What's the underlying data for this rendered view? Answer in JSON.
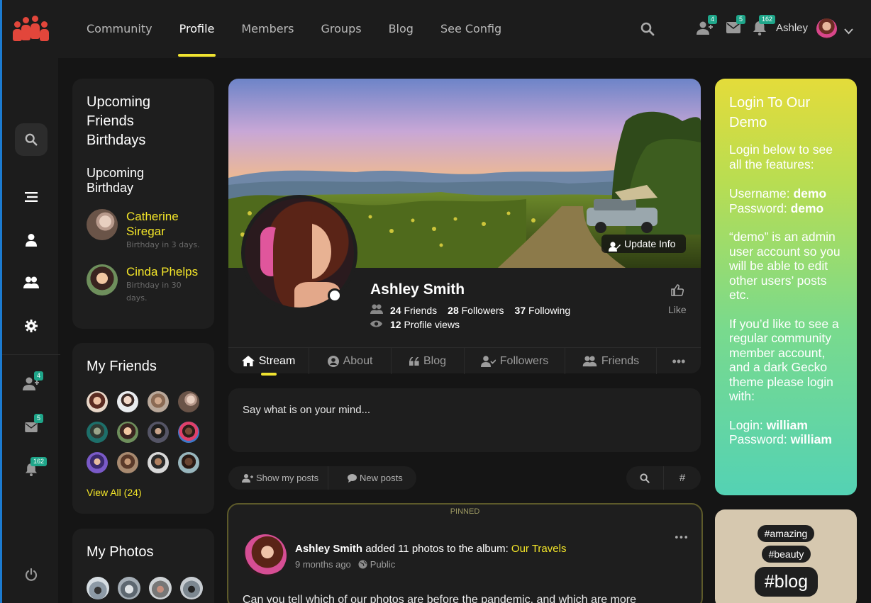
{
  "nav": {
    "items": [
      "Community",
      "Profile",
      "Members",
      "Groups",
      "Blog",
      "See Config"
    ],
    "active": "Profile"
  },
  "header": {
    "friend_requests_count": "4",
    "messages_count": "5",
    "notifications_count": "162",
    "username": "Ashley"
  },
  "sidebar_rail": {
    "friend_requests_count": "4",
    "messages_count": "5",
    "notifications_count": "162"
  },
  "birthdays": {
    "title": "Upcoming Friends Birthdays",
    "subtitle": "Upcoming Birthday",
    "items": [
      {
        "name": "Catherine Siregar",
        "when": "Birthday in 3 days."
      },
      {
        "name": "Cinda Phelps",
        "when": "Birthday in 30 days."
      }
    ]
  },
  "my_friends": {
    "title": "My Friends",
    "view_all": "View All (24)"
  },
  "my_photos": {
    "title": "My Photos"
  },
  "profile": {
    "name": "Ashley Smith",
    "friends_count": "24",
    "friends_label": "Friends",
    "followers_count": "28",
    "followers_label": "Followers",
    "following_count": "37",
    "following_label": "Following",
    "profile_views_count": "12",
    "profile_views_label": "Profile views",
    "like_label": "Like",
    "update_info": "Update Info"
  },
  "tabs": [
    "Stream",
    "About",
    "Blog",
    "Followers",
    "Friends"
  ],
  "composer": {
    "placeholder": "Say what is on your mind..."
  },
  "filters": {
    "show_my_posts": "Show my posts",
    "new_posts": "New posts"
  },
  "post": {
    "pinned_label": "PINNED",
    "author": "Ashley Smith",
    "action": "added 11 photos to the album:",
    "album": "Our Travels",
    "time": "9 months ago",
    "visibility": "Public",
    "body": "Can you tell which of our photos are before the pandemic, and which are more"
  },
  "demo": {
    "title": "Login To Our Demo",
    "intro": "Login below to see all the features:",
    "username_label": "Username:",
    "username_value": "demo",
    "password_label": "Password:",
    "password_value": "demo",
    "admin_note": "“demo” is an admin user account so you will be able to edit other users’ posts etc.",
    "regular_note": "If you’d like to see a regular community member account, and a dark Gecko theme please login with:",
    "login_label": "Login:",
    "login_value": "william",
    "password2_label": "Password:",
    "password2_value": "william"
  },
  "tags": [
    "#amazing",
    "#beauty",
    "#blog"
  ],
  "colors": {
    "accent_yellow": "#f4e629",
    "badge_green": "#1fa68a",
    "logo_red": "#e2463b",
    "background": "#151515",
    "card": "#1e1e1e"
  }
}
